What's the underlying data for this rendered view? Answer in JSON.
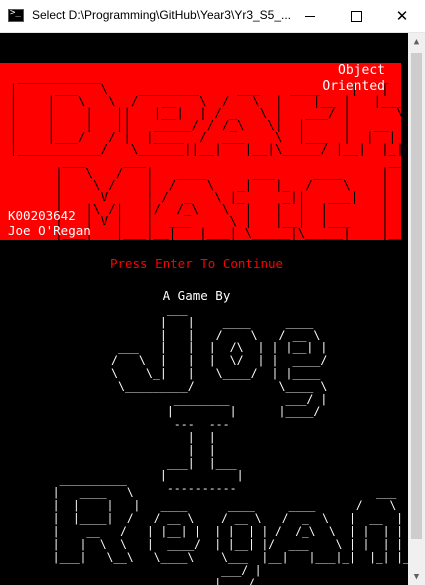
{
  "window": {
    "title": "Select D:\\Programming\\GitHub\\Year3\\Yr3_S5_...",
    "icon": "console-icon",
    "controls": {
      "minimize": "minimize-icon",
      "maximize": "maximize-icon",
      "close": "close-icon"
    }
  },
  "console": {
    "banner_color": "#ff0000",
    "subtitle": "Object\nOriented",
    "title_art": "  ___________                                   ___\n |     ___   \\    ________     ___    ____    |   |\n |    |   \\   \\  /   __   \\  /   \\  |    |__ |   |___\n |    |    |   ||   |__|  | / _   \\ |   ___/ |      \\\n |    |    |   ||   _____/ / /_\\   \\|  |     |   __  |\n |    |___/   / |  |____  /  ___    \\  |___  |  |  | |\n |___________/   \\______||__|   |__|\\_____/ |__|  |_|\n        ___     ___                                ___\n       |   \\   /   |   ____      ___     ____     |   |\n       |    \\ /    |  /    \\   _|   |_  /    \\    |   |___\n       |     V     | /  _   \\ |_     _||   ___|   |      \\\n       |   |\\ /|   |/  /_\\   \\  |   |  |  |       |   __  |\n       |   | V |   |  ___     \\ |   |__|  |___    |  |  | |\n       |___|   |___|__|   |___| \\_____|\\_____|    |__|  |_|",
    "student_id": "K00203642",
    "author_name": "Joe O'Regan",
    "press_enter": "Press Enter To Continue",
    "a_game_by": "A Game By",
    "joe_art": "         ___\n        |   |    ____     ____\n        |   |   /    \\   / __ \\\n  ___   |   |  |  /\\  | | |__| |\n /   \\  |   |  |  \\/  | |  ____/\n \\    \\_|   |   \\____/  | |____\n  \\_________/            \\____ \\\n          ________        ___/ |\n         |        |      |____/\n          ---  ---\n            |  |\n            |  |\n         ___|  |___\n        |          |\n         ----------",
    "regan_art": "  __________\n |   ____   \\                                    ___\n |  |    |   |   ____      ____     ____      /    \\   ___\n |  |____|  /   / __ \\    / __ \\   /  _  \\   |  __  | |   \\\n |    __   /   | |__| |  | |  | | /  /_\\  \\  | |  | | | |\\ \\\n |   |  \\  \\   |  ____/  | |__| |/  ___    \\ | |  | | | | \\ \\\n |___|   \\__\\   \\____\\    \\___  |__|   |___|_|  |_| |_|  \\_\\\n                          ___/ |\n                         |____/"
  }
}
